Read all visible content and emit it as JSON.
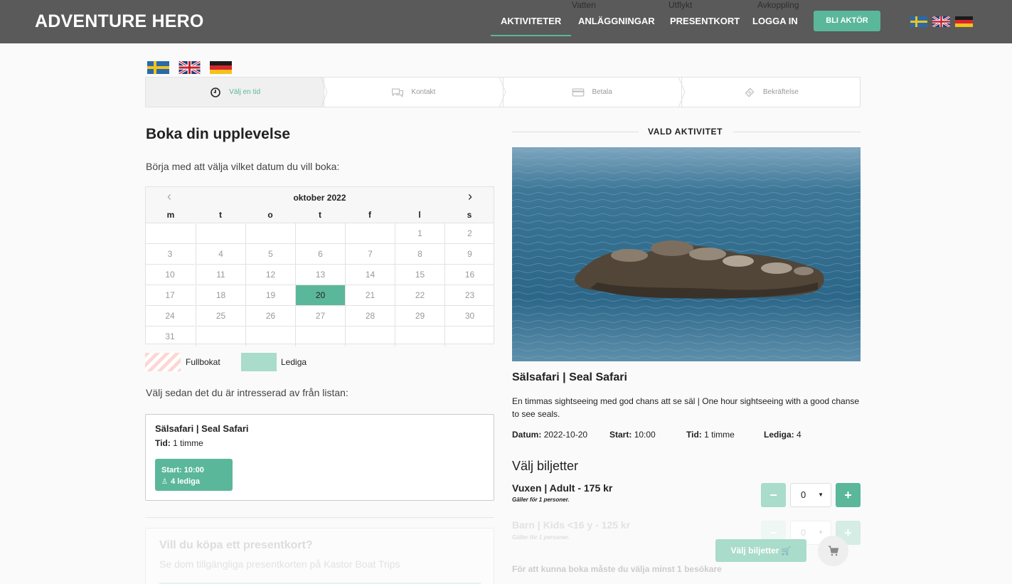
{
  "topbar": {
    "brand": "ADVENTURE HERO",
    "bg_menu": [
      "Vatten",
      "Utflykt",
      "Avkoppling"
    ],
    "nav": [
      "AKTIVITETER",
      "ANLÄGGNINGAR",
      "PRESENTKORT",
      "LOGGA IN"
    ],
    "cta": "BLI AKTÖR",
    "colors": {
      "bar": "#5a5a5a",
      "accent": "#5bb79a"
    }
  },
  "steps": [
    {
      "label": "Välj en tid",
      "icon": "clock-icon",
      "active": true
    },
    {
      "label": "Kontakt",
      "icon": "chat-icon"
    },
    {
      "label": "Betala",
      "icon": "credit-card-icon"
    },
    {
      "label": "Bekräftelse",
      "icon": "ticket-icon"
    }
  ],
  "booking": {
    "heading": "Boka din upplevelse",
    "intro": "Börja med att välja vilket datum du vill boka:",
    "calendar": {
      "month": "oktober 2022",
      "weekdays": [
        "m",
        "t",
        "o",
        "t",
        "f",
        "l",
        "s"
      ],
      "days": [
        "1",
        "2",
        "3",
        "4",
        "5",
        "6",
        "7",
        "8",
        "9",
        "10",
        "11",
        "12",
        "13",
        "14",
        "15",
        "16",
        "17",
        "18",
        "19",
        "20",
        "21",
        "22",
        "23",
        "24",
        "25",
        "26",
        "27",
        "28",
        "29",
        "30",
        "31"
      ],
      "selected": "20",
      "first_weekday_index": 5
    },
    "legend": {
      "full": "Fullbokat",
      "free": "Lediga"
    },
    "list_intro": "Välj sedan det du är intresserad av från listan:",
    "activity": {
      "title": "Sälsafari | Seal Safari",
      "time_label": "Tid:",
      "time_value": "1 timme",
      "slot_start": "Start: 10:00",
      "slot_free": "4 lediga"
    },
    "gift": {
      "title": "Vill du köpa ett presentkort?",
      "subtitle": "Se dom tillgängliga presentkorten på Kastor Boat Trips"
    }
  },
  "selected": {
    "section_label": "VALD AKTIVITET",
    "title": "Sälsafari | Seal Safari",
    "description": "En timmas sightseeing med god chans att se säl | One hour sightseeing with a good chanse to see seals.",
    "meta": {
      "date_label": "Datum:",
      "date": "2022-10-20",
      "start_label": "Start:",
      "start": "10:00",
      "time_label": "Tid:",
      "time": "1 timme",
      "free_label": "Lediga:",
      "free": "4"
    },
    "tickets_heading": "Välj biljetter",
    "tickets": [
      {
        "name": "Vuxen | Adult - 175 kr",
        "note": "Gäller för 1 personer.",
        "qty": "0"
      },
      {
        "name": "Barn | Kids <16 y - 125 kr",
        "note": "Gäller för 1 personer.",
        "qty": "0"
      }
    ],
    "submit": "Välj biljetter",
    "footnote": "För att kunna boka måste du välja minst 1 besökare"
  }
}
